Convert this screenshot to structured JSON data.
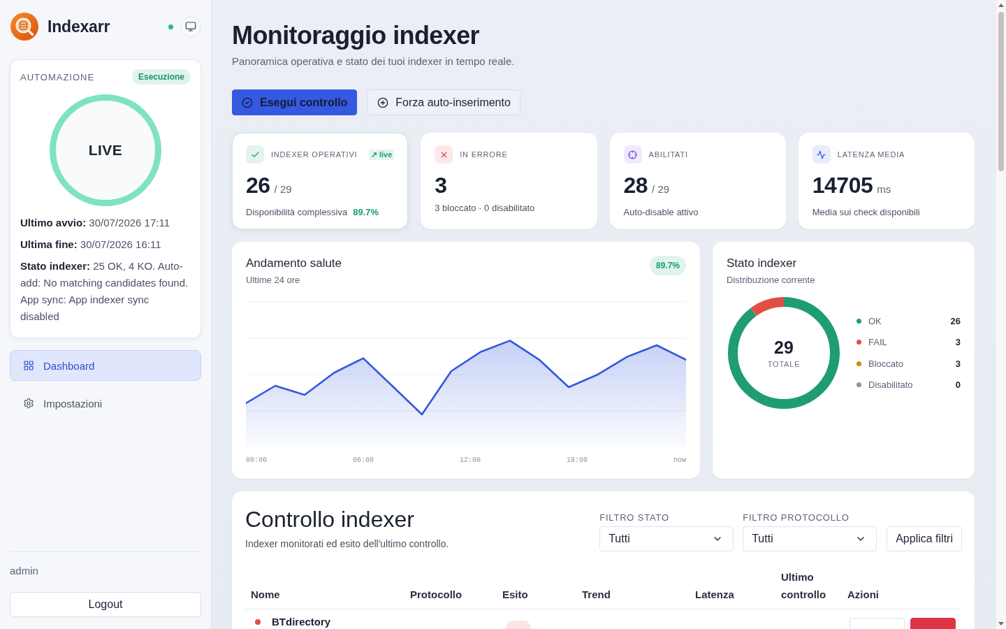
{
  "sidebar": {
    "brand": "Indexarr",
    "online": true,
    "automation": {
      "label": "AUTOMAZIONE",
      "badge": "Esecuzione",
      "running": true,
      "ring_label": "LIVE",
      "details": [
        "**Ultimo avvio:** 30/07/2026 17:11",
        "**Ultima fine:** 30/07/2026 16:11",
        "**Stato indexer:** 25 OK, 4 KO. Auto-add: No matching candidates found. App sync: App indexer sync disabled"
      ]
    },
    "nav": [
      {
        "label": "Dashboard",
        "selected": true
      },
      {
        "label": "Impostazioni",
        "selected": false
      }
    ],
    "user": "admin",
    "logout": "Logout"
  },
  "header": {
    "title": "Monitoraggio indexer",
    "subtitle": "Panoramica operativa e stato dei tuoi indexer in tempo reale.",
    "actions": [
      {
        "label": "Esegui controllo",
        "kind": "primary"
      },
      {
        "label": "Forza auto-inserimento",
        "kind": "secondary"
      }
    ]
  },
  "stats": [
    {
      "kind": "ok",
      "color": "#1f9d72",
      "label": "INDEXER OPERATIVI",
      "tag": "↗ live",
      "highlighted": true,
      "value": "26",
      "unit": "/ 29",
      "note": "Disponibilità complessiva",
      "note_value": "89.7%"
    },
    {
      "kind": "error",
      "color": "#e5484d",
      "label": "IN ERRORE",
      "highlighted": false,
      "value": "3",
      "note": "3 bloccato · 0 disabilitato"
    },
    {
      "kind": "enabled",
      "color": "#7b5ce5",
      "label": "ABILITATI",
      "highlighted": false,
      "value": "28",
      "unit": "/ 29",
      "note": "Auto-disable attivo"
    },
    {
      "kind": "latency",
      "color": "#4463df",
      "label": "LATENZA MEDIA",
      "highlighted": false,
      "value": "14705",
      "unit": "ms",
      "note": "Media sui check disponibili"
    }
  ],
  "health": {
    "title": "Andamento salute",
    "subtitle": "Ultime 24 ore",
    "badge": "89.7%",
    "x_labels": [
      "00:00",
      "06:00",
      "12:00",
      "18:00",
      "now"
    ]
  },
  "status": {
    "title": "Stato indexer",
    "subtitle": "Distribuzione corrente",
    "total": "29",
    "total_label": "TOTALE",
    "chart_data": [
      {
        "type": "donut",
        "values": [
          89.7,
          10.3
        ],
        "colors": [
          "#1f9d72",
          "#e04f44"
        ]
      }
    ],
    "legend": [
      {
        "label": "OK",
        "count": "26",
        "color": "#1f9d72"
      },
      {
        "label": "FAIL",
        "count": "3",
        "color": "#e04f44"
      },
      {
        "label": "Bloccato",
        "count": "3",
        "color": "#d4870d"
      },
      {
        "label": "Disabilitato",
        "count": "0",
        "color": "#8f96a3"
      }
    ]
  },
  "checks": {
    "title": "Controllo indexer",
    "subtitle": "Indexer monitorati ed esito dell'ultimo controllo.",
    "filters": [
      {
        "label": "FILTRO STATO",
        "value": "Tutti"
      },
      {
        "label": "FILTRO PROTOCOLLO",
        "value": "Tutti"
      }
    ],
    "apply": "Applica filtri",
    "columns": [
      "Nome",
      "Protocollo",
      "Esito",
      "Trend",
      "Latenza",
      "Ultimo controllo",
      "Azioni"
    ],
    "rows": [
      {
        "name": "BTdirectory",
        "color": "#e5484d"
      }
    ]
  }
}
